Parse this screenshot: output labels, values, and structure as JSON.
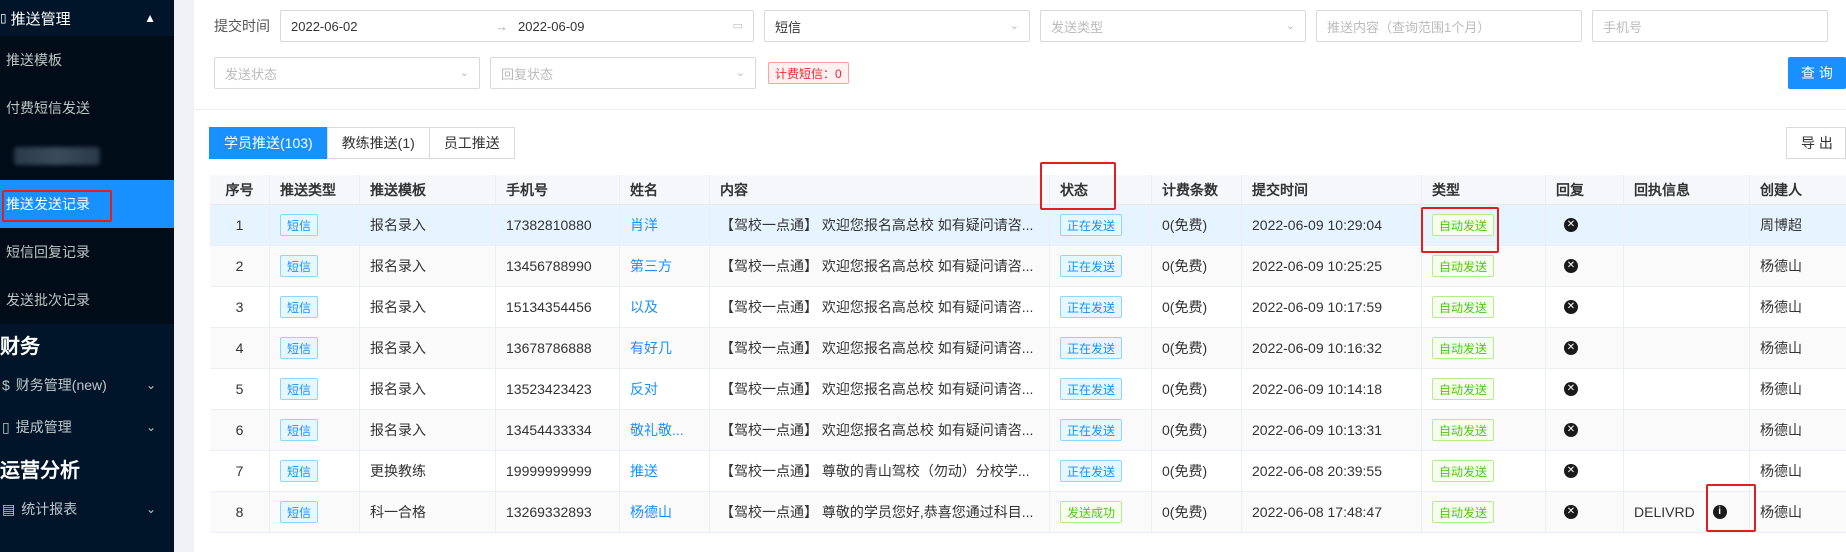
{
  "sidebar": {
    "group_title": "推送管理",
    "items": [
      {
        "label": "推送模板"
      },
      {
        "label": "付费短信发送"
      },
      {
        "label": ""
      },
      {
        "label": "推送发送记录"
      },
      {
        "label": "短信回复记录"
      },
      {
        "label": "发送批次记录"
      }
    ],
    "section_finance": "财务",
    "menu_finance": "财务管理(new)",
    "menu_withdraw": "提成管理",
    "section_ops": "运营分析",
    "menu_stats": "统计报表"
  },
  "filters": {
    "submit_time_label": "提交时间",
    "date_start": "2022-06-02",
    "date_arrow": "→",
    "date_end": "2022-06-09",
    "channel_value": "短信",
    "send_type_placeholder": "发送类型",
    "content_placeholder": "推送内容（查询范围1个月）",
    "phone_placeholder": "手机号",
    "send_status_placeholder": "发送状态",
    "reply_status_placeholder": "回复状态",
    "billing_tag": "计费短信：0",
    "query_button": "查 询"
  },
  "tabs": [
    {
      "label": "学员推送(103)",
      "active": true
    },
    {
      "label": "教练推送(1)",
      "active": false
    },
    {
      "label": "员工推送",
      "active": false
    }
  ],
  "export_label": "导 出",
  "table": {
    "headers": [
      "序号",
      "推送类型",
      "推送模板",
      "手机号",
      "姓名",
      "内容",
      "状态",
      "计费条数",
      "提交时间",
      "类型",
      "回复",
      "回执信息",
      "创建人"
    ],
    "rows": [
      {
        "idx": "1",
        "type": "短信",
        "template": "报名录入",
        "phone": "17382810880",
        "name": "肖洋",
        "content": "【驾校一点通】 欢迎您报名高总校 如有疑问请咨...",
        "status": "正在发送",
        "fee": "0(免费)",
        "time": "2022-06-09 10:29:04",
        "kind": "自动发送",
        "receipt": "",
        "creator": "周博超"
      },
      {
        "idx": "2",
        "type": "短信",
        "template": "报名录入",
        "phone": "13456788990",
        "name": "第三方",
        "content": "【驾校一点通】 欢迎您报名高总校 如有疑问请咨...",
        "status": "正在发送",
        "fee": "0(免费)",
        "time": "2022-06-09 10:25:25",
        "kind": "自动发送",
        "receipt": "",
        "creator": "杨德山"
      },
      {
        "idx": "3",
        "type": "短信",
        "template": "报名录入",
        "phone": "15134354456",
        "name": "以及",
        "content": "【驾校一点通】 欢迎您报名高总校 如有疑问请咨...",
        "status": "正在发送",
        "fee": "0(免费)",
        "time": "2022-06-09 10:17:59",
        "kind": "自动发送",
        "receipt": "",
        "creator": "杨德山"
      },
      {
        "idx": "4",
        "type": "短信",
        "template": "报名录入",
        "phone": "13678786888",
        "name": "有好几",
        "content": "【驾校一点通】 欢迎您报名高总校 如有疑问请咨...",
        "status": "正在发送",
        "fee": "0(免费)",
        "time": "2022-06-09 10:16:32",
        "kind": "自动发送",
        "receipt": "",
        "creator": "杨德山"
      },
      {
        "idx": "5",
        "type": "短信",
        "template": "报名录入",
        "phone": "13523423423",
        "name": "反对",
        "content": "【驾校一点通】 欢迎您报名高总校 如有疑问请咨...",
        "status": "正在发送",
        "fee": "0(免费)",
        "time": "2022-06-09 10:14:18",
        "kind": "自动发送",
        "receipt": "",
        "creator": "杨德山"
      },
      {
        "idx": "6",
        "type": "短信",
        "template": "报名录入",
        "phone": "13454433334",
        "name": "敬礼敬...",
        "content": "【驾校一点通】 欢迎您报名高总校 如有疑问请咨...",
        "status": "正在发送",
        "fee": "0(免费)",
        "time": "2022-06-09 10:13:31",
        "kind": "自动发送",
        "receipt": "",
        "creator": "杨德山"
      },
      {
        "idx": "7",
        "type": "短信",
        "template": "更换教练",
        "phone": "19999999999",
        "name": "推送",
        "content": "【驾校一点通】 尊敬的青山驾校（勿动）分校学...",
        "status": "正在发送",
        "fee": "0(免费)",
        "time": "2022-06-08 20:39:55",
        "kind": "自动发送",
        "receipt": "",
        "creator": "杨德山"
      },
      {
        "idx": "8",
        "type": "短信",
        "template": "科一合格",
        "phone": "13269332893",
        "name": "杨德山",
        "content": "【驾校一点通】 尊敬的学员您好,恭喜您通过科目...",
        "status": "发送成功",
        "fee": "0(免费)",
        "time": "2022-06-08 17:48:47",
        "kind": "自动发送",
        "receipt": "DELIVRD",
        "creator": "杨德山"
      }
    ]
  }
}
